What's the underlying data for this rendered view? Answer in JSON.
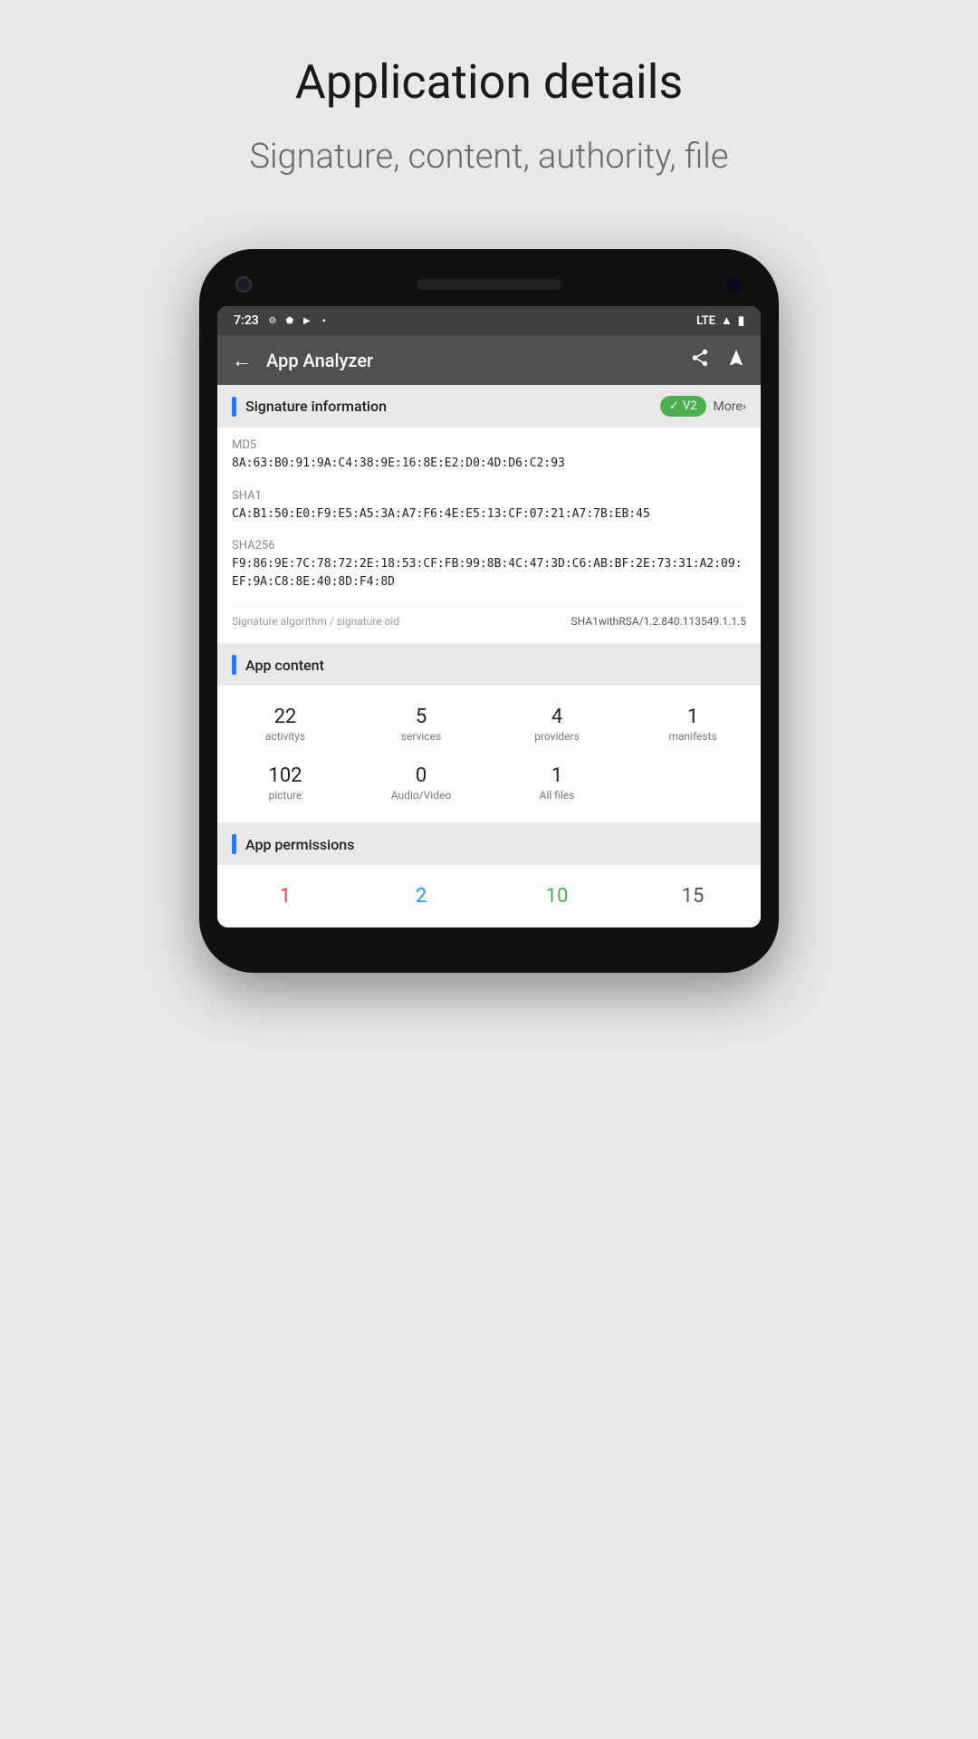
{
  "page": {
    "title": "Application details",
    "subtitle": "Signature, content, authority, file"
  },
  "status_bar": {
    "time": "7:23",
    "signal": "LTE",
    "icons": [
      "⚙",
      "🛡",
      "▶",
      "📋"
    ]
  },
  "toolbar": {
    "title": "App Analyzer",
    "back_label": "←",
    "share_label": "share",
    "navigation_label": "navigate"
  },
  "signature_section": {
    "title": "Signature information",
    "badge": "V2",
    "more_label": "More",
    "md5_label": "MD5",
    "md5_value": "8A:63:B0:91:9A:C4:38:9E:16:8E:E2:D0:4D:D6:C2:93",
    "sha1_label": "SHA1",
    "sha1_value": "CA:B1:50:E0:F9:E5:A5:3A:A7:F6:4E:E5:13:CF:07:21:A7:7B:EB:45",
    "sha256_label": "SHA256",
    "sha256_value": "F9:86:9E:7C:78:72:2E:18:53:CF:FB:99:8B:4C:47:3D:C6:AB:BF:2E:73:31:A2:09:EF:9A:C8:8E:40:8D:F4:8D",
    "algo_label": "Signature algorithm / signature oid",
    "algo_value": "SHA1withRSA/1.2.840.113549.1.1.5"
  },
  "content_section": {
    "title": "App content",
    "items": [
      {
        "number": "22",
        "label": "activitys"
      },
      {
        "number": "5",
        "label": "services"
      },
      {
        "number": "4",
        "label": "providers"
      },
      {
        "number": "1",
        "label": "manifests"
      },
      {
        "number": "102",
        "label": "picture"
      },
      {
        "number": "0",
        "label": "Audio/Video"
      },
      {
        "number": "1",
        "label": "All files"
      }
    ]
  },
  "permissions_section": {
    "title": "App permissions",
    "items": [
      {
        "number": "1",
        "color": "red"
      },
      {
        "number": "2",
        "color": "blue"
      },
      {
        "number": "10",
        "color": "green"
      },
      {
        "number": "15",
        "color": "gray"
      }
    ]
  }
}
